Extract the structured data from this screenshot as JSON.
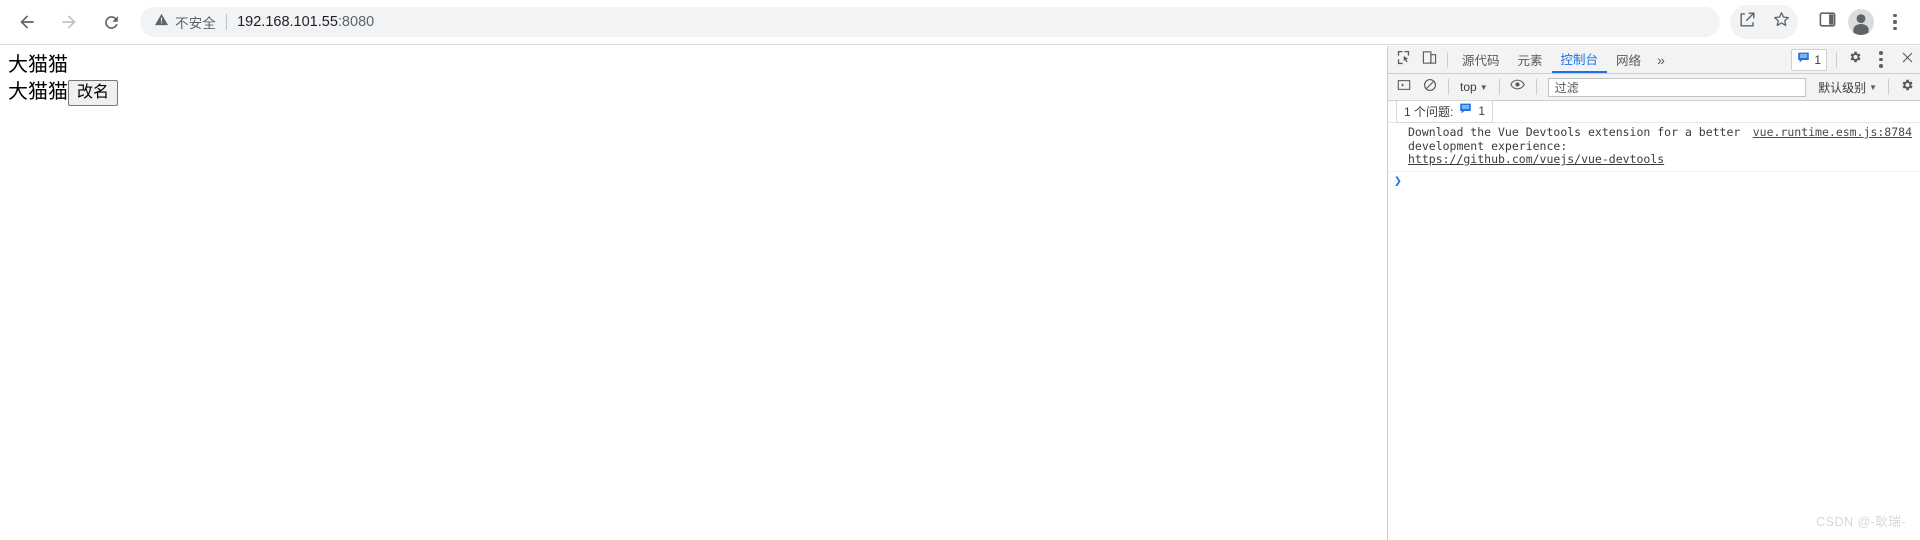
{
  "browser": {
    "nav": {
      "back_label": "Back",
      "forward_label": "Forward",
      "reload_label": "Reload"
    },
    "omnibox": {
      "security_label": "不安全",
      "url_host": "192.168.101.55",
      "url_port": ":8080"
    },
    "actions": {
      "share_label": "Share",
      "bookmark_label": "Bookmark",
      "side_panel_label": "Side panel",
      "profile_label": "Profile",
      "menu_label": "Customize and control"
    }
  },
  "page": {
    "heading_text": "大猫猫",
    "name_text": "大猫猫",
    "rename_button_label": "改名"
  },
  "devtools": {
    "tabs": [
      {
        "label": "源代码",
        "active": false
      },
      {
        "label": "元素",
        "active": false
      },
      {
        "label": "控制台",
        "active": true
      },
      {
        "label": "网络",
        "active": false
      }
    ],
    "more_tabs_label": "»",
    "message_badge_count": "1",
    "settings_label": "设置",
    "menu_label": "更多选项",
    "close_label": "关闭",
    "console_toolbar": {
      "sidebar_toggle_label": "控制台边栏",
      "clear_label": "清除控制台",
      "context_value": "top",
      "eye_label": "实时表达式",
      "filter_placeholder": "过滤",
      "filter_value": "",
      "level_value": "默认级别",
      "settings_label": "控制台设置"
    },
    "issues_bar": {
      "text": "1 个问题:",
      "count": "1"
    },
    "console_messages": [
      {
        "text": "Download the Vue Devtools extension for a better development experience:\n",
        "link": "https://github.com/vuejs/vue-devtools",
        "source": "vue.runtime.esm.js:8784"
      }
    ],
    "prompt_caret": "❯"
  },
  "watermark": "CSDN @-耿瑞-",
  "colors": {
    "accent": "#1a73e8",
    "toolbar_bg": "#f3f3f3",
    "omnibox_bg": "#f1f3f4",
    "text_muted": "#5f6368"
  }
}
